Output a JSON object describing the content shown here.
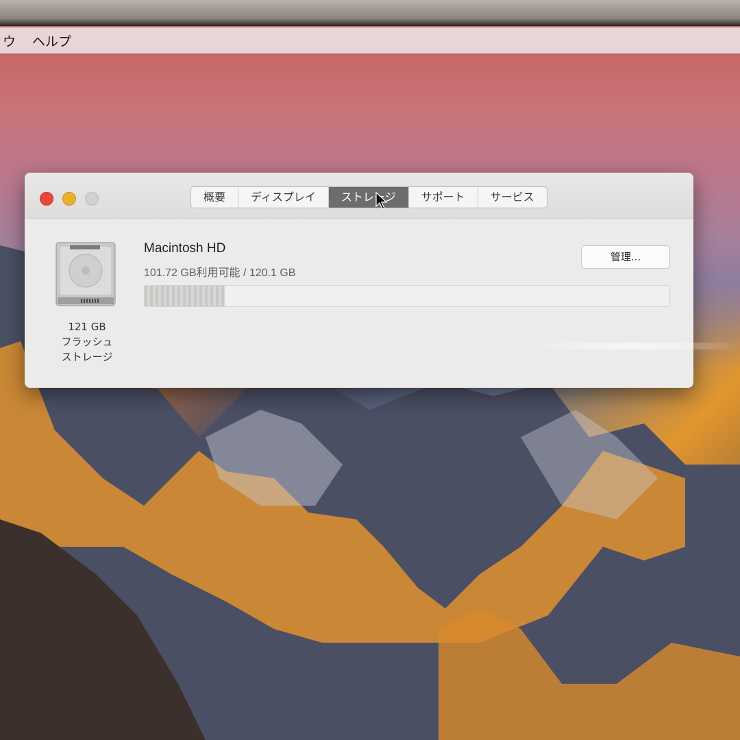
{
  "menubar": {
    "items": [
      "ウ",
      "ヘルプ"
    ]
  },
  "window": {
    "tabs": [
      {
        "label": "概要",
        "active": false
      },
      {
        "label": "ディスプレイ",
        "active": false
      },
      {
        "label": "ストレージ",
        "active": true
      },
      {
        "label": "サポート",
        "active": false
      },
      {
        "label": "サービス",
        "active": false
      }
    ],
    "disk": {
      "caption": [
        "121 GB",
        "フラッシュ",
        "ストレージ"
      ],
      "name": "Macintosh HD",
      "availability": "101.72 GB利用可能 / 120.1 GB",
      "manage_label": "管理...",
      "used_fraction": 0.153
    }
  },
  "colors": {
    "close": "#e8483c",
    "minimize": "#e8b02c",
    "active_tab": "#6e6d6c"
  },
  "icons": [
    "close-icon",
    "minimize-icon",
    "zoom-icon",
    "hard-drive-icon",
    "pointer-cursor-icon"
  ]
}
